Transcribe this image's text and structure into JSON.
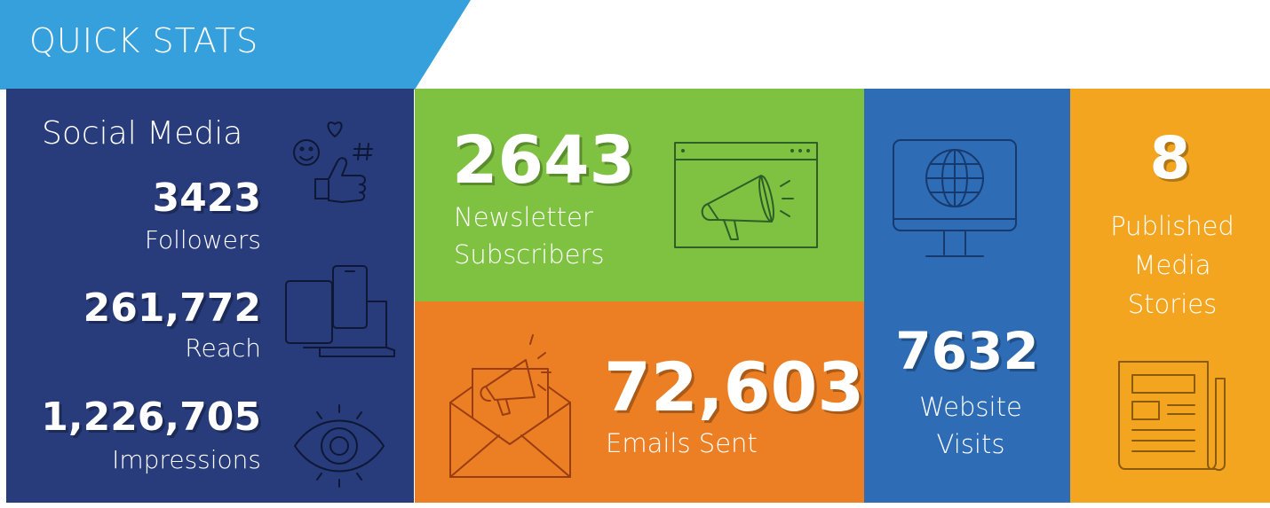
{
  "header": {
    "title": "QUICK STATS"
  },
  "social": {
    "heading": "Social Media",
    "followers": {
      "value": "3423",
      "label": "Followers"
    },
    "reach": {
      "value": "261,772",
      "label": "Reach"
    },
    "impressions": {
      "value": "1,226,705",
      "label": "Impressions"
    }
  },
  "newsletter": {
    "value": "2643",
    "label_line1": "Newsletter",
    "label_line2": "Subscribers"
  },
  "emails": {
    "value": "72,603",
    "label": "Emails Sent"
  },
  "website": {
    "value": "7632",
    "label_line1": "Website",
    "label_line2": "Visits"
  },
  "media": {
    "value": "8",
    "label_line1": "Published",
    "label_line2": "Media",
    "label_line3": "Stories"
  },
  "icons": {
    "social": "social-reactions-icon",
    "devices": "devices-icon",
    "eye": "eye-icon",
    "newsletter": "browser-megaphone-icon",
    "email": "envelope-megaphone-icon",
    "website": "monitor-globe-icon",
    "media": "newspaper-icon"
  },
  "colors": {
    "banner": "#35a0db",
    "social": "#283b7a",
    "newsletter": "#7fc242",
    "emails": "#ec7f23",
    "website": "#2f6cb6",
    "media": "#f3a51f"
  }
}
